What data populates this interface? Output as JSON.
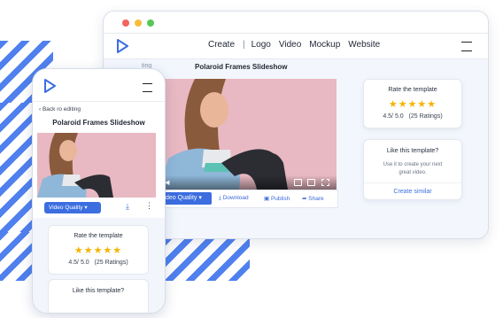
{
  "browser": {
    "nav": [
      "Create",
      "Logo",
      "Video",
      "Mockup",
      "Website"
    ],
    "breadcrumb": "ting",
    "page_title": "Polaroid Frames Slideshow",
    "video_quality": "deo Quality",
    "actions": {
      "download": "Download",
      "publish": "Publish",
      "share": "Share"
    },
    "rate_card": {
      "title": "Rate the template",
      "stars": "★★★★★",
      "score": "4.5/ 5.0",
      "ratings": "(25 Ratings)"
    },
    "like_card": {
      "title": "Like this template?",
      "desc": "Use it to create your next great video.",
      "link": "Create similar"
    }
  },
  "phone": {
    "back": "‹ Back ro editing",
    "page_title": "Polaroid Frames Slideshow",
    "video_quality": "Video Quality",
    "rate_card": {
      "title": "Rate the template",
      "stars": "★★★★★",
      "score": "4.5/ 5.0",
      "ratings": "(25 Ratings)"
    },
    "like_card": {
      "title": "Like this template?"
    }
  },
  "colors": {
    "accent": "#3c6ee0",
    "stripe": "#4f80ee",
    "star": "#f4b400",
    "photo_bg": "#e8b9c2"
  }
}
